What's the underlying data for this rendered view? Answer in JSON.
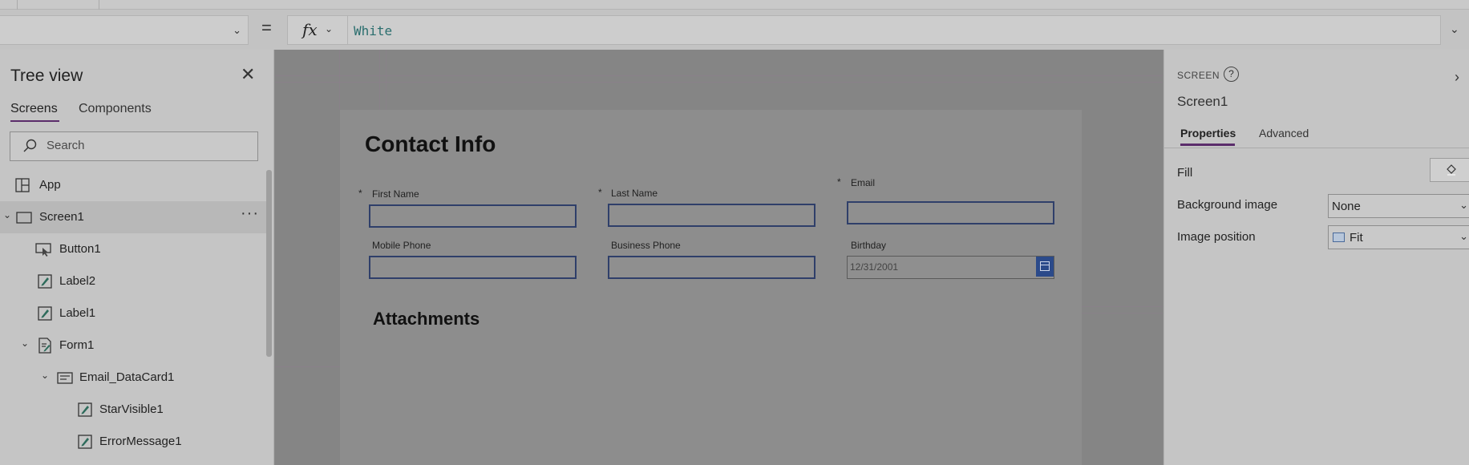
{
  "formula_bar": {
    "property": "",
    "equals": "=",
    "fx": "fx",
    "formula": "White"
  },
  "tree": {
    "title": "Tree view",
    "tabs": [
      "Screens",
      "Components"
    ],
    "search_placeholder": "Search",
    "more": "···",
    "nodes": [
      {
        "label": "App",
        "icon": "app-icon"
      },
      {
        "label": "Screen1",
        "icon": "screen-icon",
        "selected": true
      },
      {
        "label": "Button1",
        "icon": "button-icon"
      },
      {
        "label": "Label2",
        "icon": "label-icon"
      },
      {
        "label": "Label1",
        "icon": "label-icon"
      },
      {
        "label": "Form1",
        "icon": "form-icon"
      },
      {
        "label": "Email_DataCard1",
        "icon": "datacard-icon"
      },
      {
        "label": "StarVisible1",
        "icon": "label-icon"
      },
      {
        "label": "ErrorMessage1",
        "icon": "label-icon"
      }
    ]
  },
  "canvas": {
    "title": "Contact Info",
    "section": "Attachments",
    "required_mark": "*",
    "fields": {
      "first_name": "First Name",
      "last_name": "Last Name",
      "email": "Email",
      "mobile_phone": "Mobile Phone",
      "business_phone": "Business Phone",
      "birthday": "Birthday",
      "birthday_value": "12/31/2001"
    }
  },
  "properties": {
    "kind": "SCREEN",
    "help": "?",
    "name": "Screen1",
    "tabs": [
      "Properties",
      "Advanced"
    ],
    "fill_label": "Fill",
    "background_image_label": "Background image",
    "background_image_value": "None",
    "image_position_label": "Image position",
    "image_position_value": "Fit"
  }
}
